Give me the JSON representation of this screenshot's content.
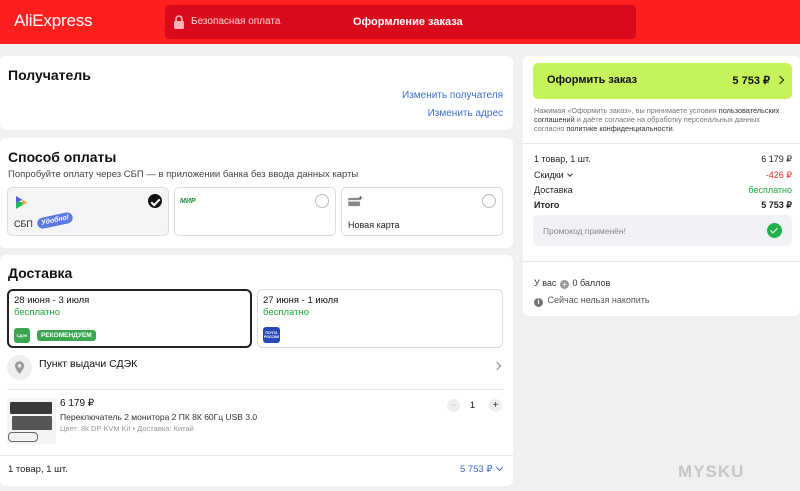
{
  "header": {
    "logo": "AliExpress",
    "secure_payment": "Безопасная оплата",
    "title": "Оформление заказа"
  },
  "recipient": {
    "heading": "Получатель",
    "change_recipient": "Изменить получателя",
    "change_address": "Изменить адрес"
  },
  "payment": {
    "heading": "Способ оплаты",
    "subtitle": "Попробуйте оплату через СБП — в приложении банка без ввода данных карты",
    "sbp_label": "СБП",
    "sbp_badge": "Удобно!",
    "mir_label": "МИР",
    "new_card_label": "Новая карта"
  },
  "delivery": {
    "heading": "Доставка",
    "option1_dates": "28 июня - 3 июля",
    "option1_price": "бесплатно",
    "option1_carrier": "СДЭК",
    "option1_badge": "РЕКОМЕНДУЕМ",
    "option2_dates": "27 июня - 1 июля",
    "option2_price": "бесплатно",
    "option2_carrier": "ПОЧТА РОССИИ",
    "pickup_label": "Пункт выдачи СДЭК"
  },
  "product": {
    "price": "6 179 ₽",
    "title": "Переключатель 2 монитора 2 ПК 8К 60Гц USB 3.0",
    "meta": "Цвет: 8k DP KVM Kit • Доставка: Китай",
    "quantity": "1",
    "minus": "−",
    "plus": "+"
  },
  "footer": {
    "count": "1 товар, 1 шт.",
    "total": "5 753 ₽"
  },
  "summary": {
    "order_button": "Оформить заказ",
    "order_total": "5 753 ₽",
    "terms_1": "Нажимая «Оформить заказ», вы принимаете условия ",
    "terms_link1": "пользовательских соглашений",
    "terms_2": " и даёте согласие на обработку персональных данных согласно ",
    "terms_link2": "политике конфиденциальности",
    "terms_3": ".",
    "items_label": "1 товар, 1 шт.",
    "items_value": "6 179 ₽",
    "discount_label": "Скидки",
    "discount_value": "-426 ₽",
    "delivery_label": "Доставка",
    "delivery_value": "бесплатно",
    "total_label": "Итого",
    "total_value": "5 753 ₽",
    "promo": "Промокод применён!",
    "points_prefix": "У вас",
    "points_value": "0 баллов",
    "points_note": "Сейчас нельзя накопить"
  },
  "watermark": "MYSKU",
  "colors": {
    "brand_red": "#ff1f1f",
    "order_button": "#c6f25b",
    "link_blue": "#3a6fcf",
    "green": "#1aaa3a",
    "discount_red": "#e8302a"
  }
}
